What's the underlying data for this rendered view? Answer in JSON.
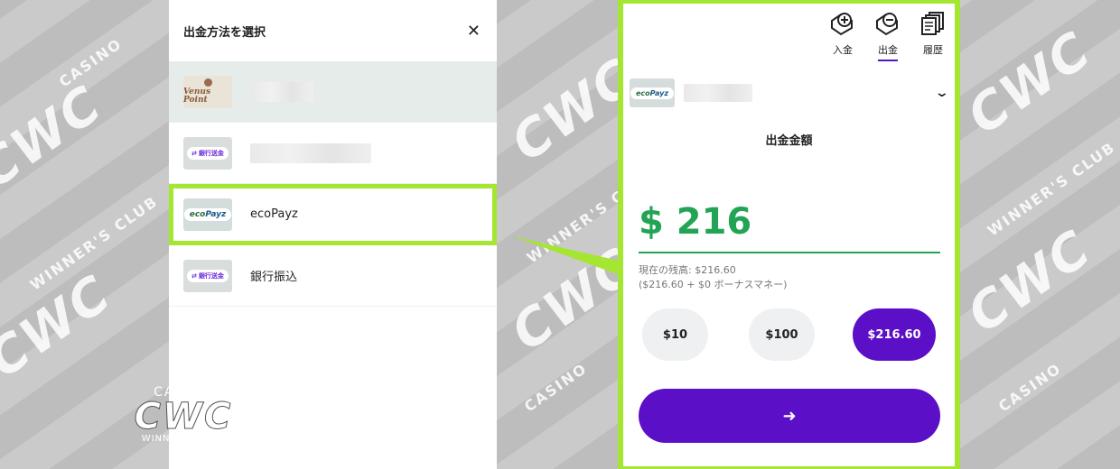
{
  "watermark": {
    "big": "CWC",
    "small": "CASINO",
    "club": "WINNER'S CLUB"
  },
  "logo": {
    "casino": "CASINO",
    "main": "CWC",
    "club": "WINNER'S CLUB"
  },
  "method_panel": {
    "title": "出金方法を選択",
    "close": "✕",
    "methods": [
      {
        "logo_text": "Venus Point",
        "label": ""
      },
      {
        "logo_text": "銀行送金",
        "label": ""
      },
      {
        "logo_text": "ecoPayz",
        "label": "ecoPayz"
      },
      {
        "logo_text": "銀行送金",
        "label": "銀行振込"
      }
    ]
  },
  "withdraw_panel": {
    "tabs": [
      {
        "label": "入金",
        "icon": "deposit-icon"
      },
      {
        "label": "出金",
        "icon": "withdraw-icon",
        "active": true
      },
      {
        "label": "履歴",
        "icon": "history-icon"
      }
    ],
    "provider_logo": "ecoPayz",
    "amount_title": "出金金額",
    "amount_value": "$ 216",
    "balance_line1": "現在の残高: $216.60",
    "balance_line2": "($216.60 + $0 ボーナスマネー)",
    "quick_amounts": [
      "$10",
      "$100",
      "$216.60"
    ],
    "submit_icon": "➜"
  },
  "colors": {
    "accent_purple": "#5b0fc7",
    "amount_green": "#23a455",
    "highlight_lime": "#a5e632"
  }
}
